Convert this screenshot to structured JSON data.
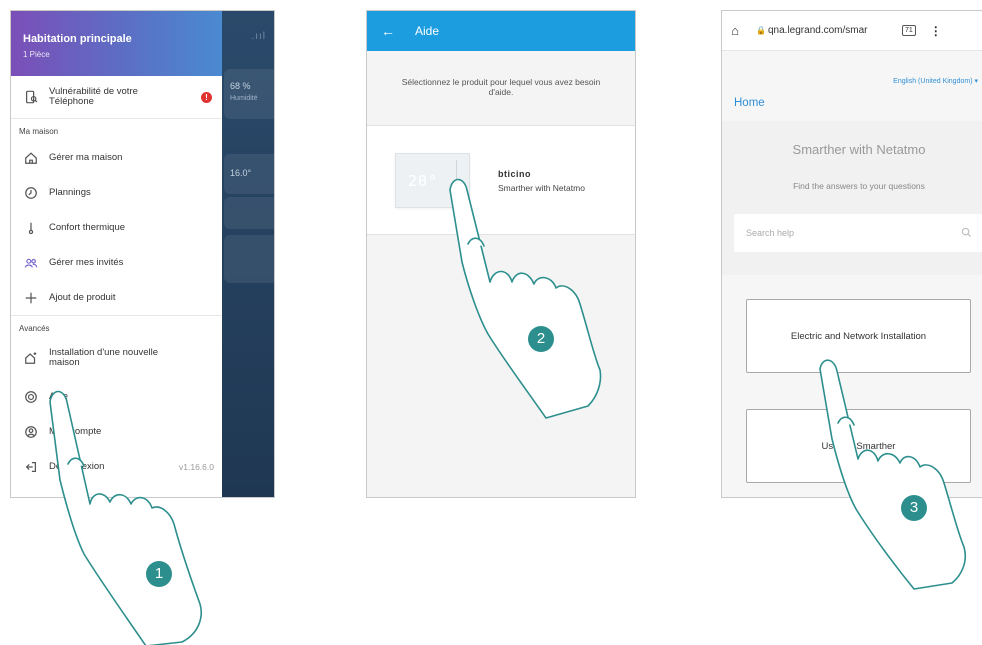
{
  "screen1": {
    "home_name": "Habitation principale",
    "room_count": "1 Pièce",
    "vulnerability_label": "Vulnérabilité de votre Téléphone",
    "alert_badge": "!",
    "section_home": "Ma maison",
    "menu": [
      {
        "label": "Gérer ma maison",
        "icon": "house-icon"
      },
      {
        "label": "Plannings",
        "icon": "clock-icon"
      },
      {
        "label": "Confort thermique",
        "icon": "thermometer-icon"
      },
      {
        "label": "Gérer mes invités",
        "icon": "guests-icon"
      },
      {
        "label": "Ajout de produit",
        "icon": "plus-icon"
      }
    ],
    "section_advanced": "Avancés",
    "advanced": [
      {
        "label": "Installation d'une nouvelle maison",
        "icon": "new-house-icon"
      },
      {
        "label": "Aide",
        "icon": "lifebuoy-icon"
      },
      {
        "label": "Mon compte",
        "icon": "user-icon"
      },
      {
        "label": "Déconnexion",
        "icon": "logout-icon"
      }
    ],
    "version": "v1.16.6.0",
    "background": {
      "humidity": "68 %",
      "humidity_label": "Humidité",
      "temperature": "16.0°"
    }
  },
  "screen2": {
    "title": "Aide",
    "intro": "Sélectionnez le produit pour lequel vous avez besoin d'aide.",
    "thermostat_display": "20°",
    "brand": "bticino",
    "product_name": "Smarther with Netatmo"
  },
  "screen3": {
    "url": "qna.legrand.com/smar",
    "tab_count": "71",
    "language": "English (United Kingdom)",
    "home_link": "Home",
    "title": "Smarther with Netatmo",
    "subtitle": "Find the answers to your questions",
    "search_placeholder": "Search help",
    "categories": [
      "Electric and Network Installation",
      "Use my Smarther"
    ]
  },
  "steps": [
    "1",
    "2",
    "3"
  ],
  "colors": {
    "accent": "#1b9de0",
    "step": "#2c8f8d",
    "alert": "#e0322f",
    "link": "#2f8fd6"
  }
}
